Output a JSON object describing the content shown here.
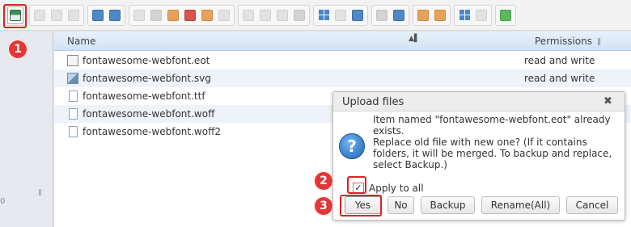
{
  "toolbar": {
    "groups": [
      {
        "buttons": [
          {
            "icon": "save-upload-icon",
            "style": "save",
            "active": true
          }
        ]
      },
      {
        "buttons": [
          {
            "icon": "copy-icon",
            "style": "light"
          },
          {
            "icon": "disk-icon",
            "style": "light"
          },
          {
            "icon": "document-icon",
            "style": "light"
          }
        ]
      },
      {
        "buttons": [
          {
            "icon": "undo-icon",
            "style": "blue"
          },
          {
            "icon": "redo-icon",
            "style": "blue"
          }
        ]
      },
      {
        "buttons": [
          {
            "icon": "duplicate-icon",
            "style": "light"
          },
          {
            "icon": "cut-icon",
            "style": "gray"
          },
          {
            "icon": "paste-icon",
            "style": "orange"
          },
          {
            "icon": "delete-icon",
            "style": "red"
          },
          {
            "icon": "archive-icon",
            "style": "orange"
          },
          {
            "icon": "extract-icon",
            "style": "light"
          }
        ]
      },
      {
        "buttons": [
          {
            "icon": "new-file-icon",
            "style": "light"
          },
          {
            "icon": "rename-icon",
            "style": "light"
          },
          {
            "icon": "edit-icon",
            "style": "light"
          },
          {
            "icon": "settings-icon",
            "style": "gray"
          }
        ]
      },
      {
        "buttons": [
          {
            "icon": "grid-view-icon",
            "style": "grid"
          },
          {
            "icon": "select-all-icon",
            "style": "light"
          },
          {
            "icon": "list-view-icon",
            "style": "blue"
          }
        ]
      },
      {
        "buttons": [
          {
            "icon": "preview-eye-icon",
            "style": "gray"
          },
          {
            "icon": "info-icon",
            "style": "blue"
          }
        ]
      },
      {
        "buttons": [
          {
            "icon": "move-left-icon",
            "style": "orange"
          },
          {
            "icon": "move-right-icon",
            "style": "orange"
          }
        ]
      },
      {
        "buttons": [
          {
            "icon": "view-icons-icon",
            "style": "grid"
          },
          {
            "icon": "view-list-icon",
            "style": "light"
          }
        ]
      },
      {
        "buttons": [
          {
            "icon": "fullscreen-icon",
            "style": "green"
          }
        ]
      }
    ]
  },
  "columns": {
    "name": "Name",
    "permissions": "Permissions",
    "sort_glyph": "▲▌"
  },
  "files": [
    {
      "name": "fontawesome-webfont.eot",
      "permission": "read and write",
      "icon": "eot"
    },
    {
      "name": "fontawesome-webfont.svg",
      "permission": "read and write",
      "icon": "svg"
    },
    {
      "name": "fontawesome-webfont.ttf",
      "permission": "",
      "icon": "doc"
    },
    {
      "name": "fontawesome-webfont.woff",
      "permission": "",
      "icon": "doc"
    },
    {
      "name": "fontawesome-webfont.woff2",
      "permission": "",
      "icon": "doc"
    }
  ],
  "dialog": {
    "title": "Upload files",
    "close": "✖",
    "question_glyph": "?",
    "message_lines": [
      "Item named \"fontawesome-webfont.eot\" already",
      "exists.",
      "Replace old file with new one? (If it contains",
      "folders, it will be merged. To backup and replace,",
      "select Backup.)"
    ],
    "apply_all_label": "Apply to all",
    "apply_all_checked": true,
    "check_glyph": "✓",
    "buttons": {
      "yes": "Yes",
      "no": "No",
      "backup": "Backup",
      "rename_all": "Rename(All)",
      "cancel": "Cancel"
    }
  },
  "annotations": {
    "step1": "1",
    "step2": "2",
    "step3": "3"
  },
  "left_panel": {
    "mark": "0"
  },
  "colors": {
    "highlight_red": "#e02020",
    "badge_red": "#e53535",
    "header_blue": "#d2e2f4",
    "row_alt": "#eef3f9"
  }
}
